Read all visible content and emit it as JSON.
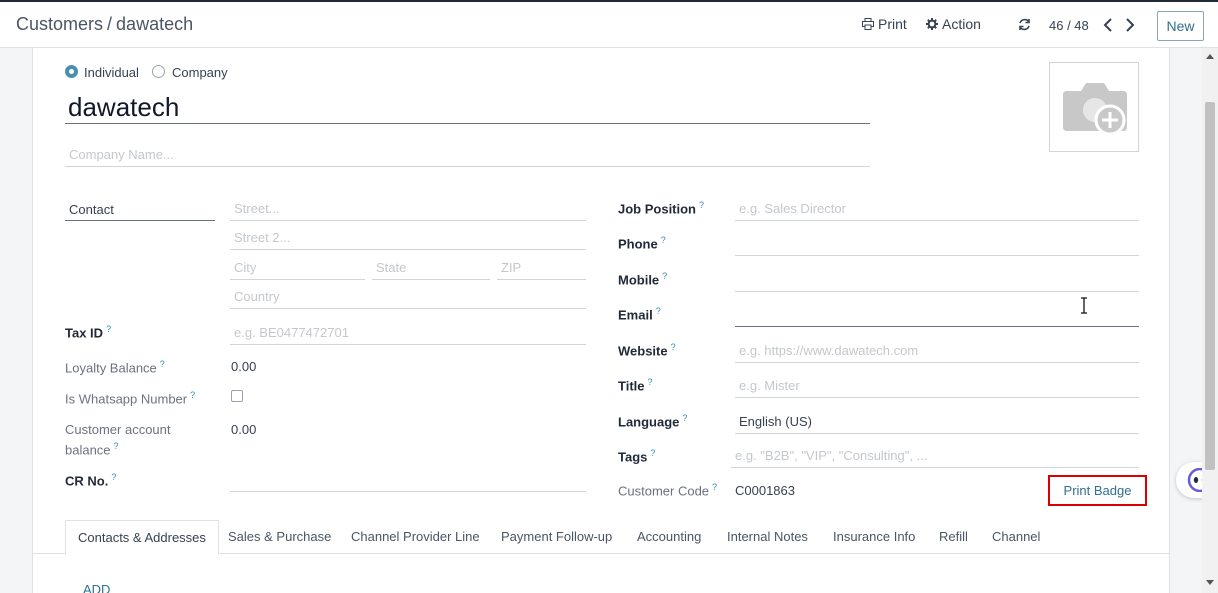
{
  "header": {
    "breadcrumb_parent": "Customers",
    "breadcrumb_sep": "/",
    "breadcrumb_current": "dawatech",
    "print_label": "Print",
    "action_label": "Action",
    "pager": "46 / 48",
    "new_label": "New"
  },
  "form": {
    "type_individual": "Individual",
    "type_company": "Company",
    "name": "dawatech",
    "company_placeholder": "Company Name...",
    "address_type": "Contact",
    "street_ph": "Street...",
    "street2_ph": "Street 2...",
    "city_ph": "City",
    "state_ph": "State",
    "zip_ph": "ZIP",
    "country_ph": "Country",
    "tax_id_label": "Tax ID",
    "tax_id_ph": "e.g. BE0477472701",
    "loyalty_label": "Loyalty Balance",
    "loyalty_value": "0.00",
    "whatsapp_label": "Is Whatsapp Number",
    "cust_balance_label_1": "Customer account",
    "cust_balance_label_2": "balance",
    "cust_balance_value": "0.00",
    "cr_label": "CR No.",
    "job_label": "Job Position",
    "job_ph": "e.g. Sales Director",
    "phone_label": "Phone",
    "mobile_label": "Mobile",
    "email_label": "Email",
    "website_label": "Website",
    "website_ph": "e.g. https://www.dawatech.com",
    "title_label": "Title",
    "title_ph": "e.g. Mister",
    "language_label": "Language",
    "language_value": "English (US)",
    "tags_label": "Tags",
    "tags_ph": "e.g. \"B2B\", \"VIP\", \"Consulting\", ...",
    "customer_code_label": "Customer Code",
    "customer_code_value": "C0001863",
    "print_badge": "Print Badge",
    "help_mark": "?"
  },
  "tabs": [
    "Contacts & Addresses",
    "Sales & Purchase",
    "Channel Provider Line",
    "Payment Follow-up",
    "Accounting",
    "Internal Notes",
    "Insurance Info",
    "Refill",
    "Channel"
  ],
  "add_label": "ADD",
  "colors": {
    "accent": "#2f6f8f",
    "radio": "#4b8fb0",
    "highlight": "#d80000"
  }
}
